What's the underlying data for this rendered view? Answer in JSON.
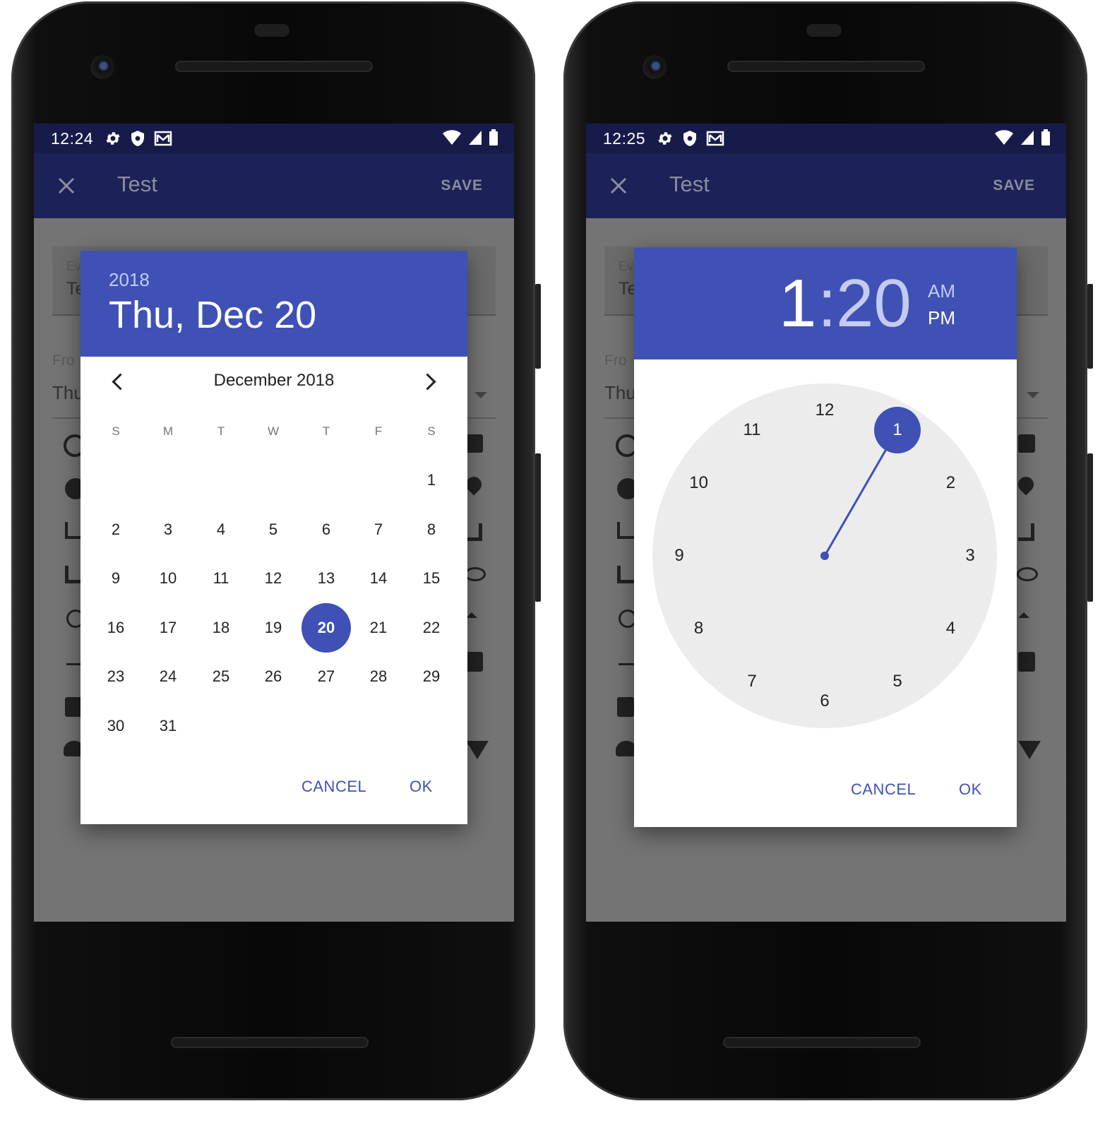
{
  "left_phone": {
    "status": {
      "time": "12:24"
    },
    "appbar": {
      "title": "Test",
      "save": "SAVE"
    },
    "background": {
      "field_label": "Ev",
      "field_value": "Te",
      "from_label": "Fro",
      "from_value": "Thu"
    },
    "date_picker": {
      "year": "2018",
      "selected_date": "Thu, Dec 20",
      "month_label": "December 2018",
      "weekdays": [
        "S",
        "M",
        "T",
        "W",
        "T",
        "F",
        "S"
      ],
      "days": [
        "1",
        "2",
        "3",
        "4",
        "5",
        "6",
        "7",
        "8",
        "9",
        "10",
        "11",
        "12",
        "13",
        "14",
        "15",
        "16",
        "17",
        "18",
        "19",
        "20",
        "21",
        "22",
        "23",
        "24",
        "25",
        "26",
        "27",
        "28",
        "29",
        "30",
        "31"
      ],
      "selected_day": "20",
      "cancel": "CANCEL",
      "ok": "OK"
    }
  },
  "right_phone": {
    "status": {
      "time": "12:25"
    },
    "appbar": {
      "title": "Test",
      "save": "SAVE"
    },
    "background": {
      "field_label": "Ev",
      "field_value": "Te",
      "from_label": "Fro",
      "from_value": "Thu"
    },
    "time_picker": {
      "hour": "1",
      "colon": ":",
      "minute": "20",
      "am": "AM",
      "pm": "PM",
      "dial_numbers": [
        "12",
        "1",
        "2",
        "3",
        "4",
        "5",
        "6",
        "7",
        "8",
        "9",
        "10",
        "11"
      ],
      "selected_hour": "1",
      "cancel": "CANCEL",
      "ok": "OK"
    }
  },
  "colors": {
    "accent": "#3f51b5",
    "appbar": "#1c2257",
    "statusbar": "#161b4a",
    "scrim": "#747474"
  }
}
